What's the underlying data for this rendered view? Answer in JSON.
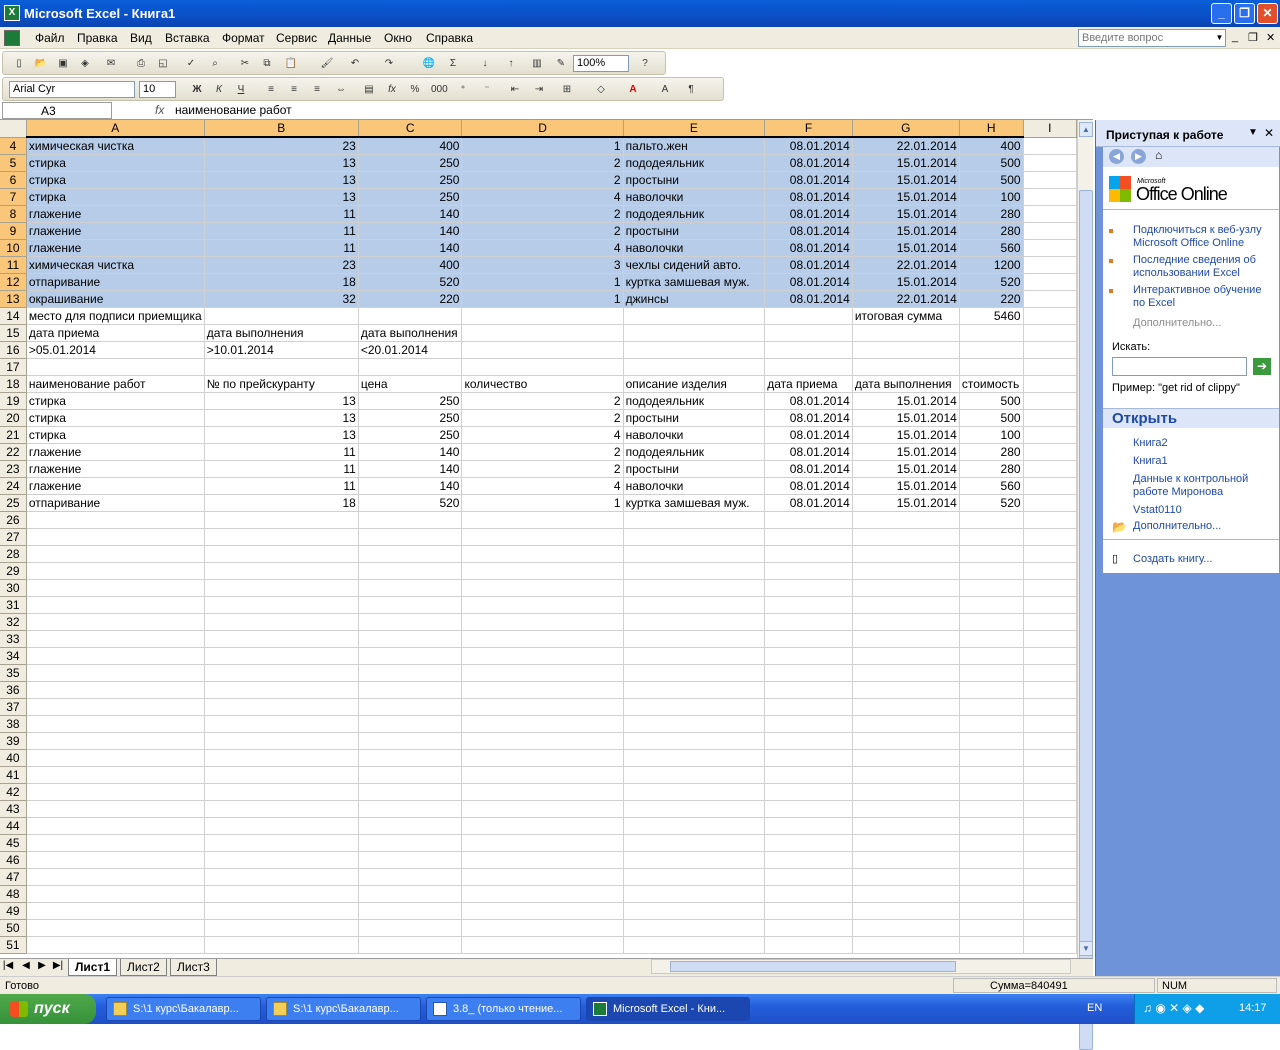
{
  "window": {
    "title": "Microsoft Excel - Книга1"
  },
  "menu": [
    "Файл",
    "Правка",
    "Вид",
    "Вставка",
    "Формат",
    "Сервис",
    "Данные",
    "Окно",
    "Справка"
  ],
  "ask_placeholder": "Введите вопрос",
  "toolbar": {
    "zoom": "100%",
    "font": "Arial Cyr",
    "size": "10"
  },
  "formula_bar": {
    "cell_ref": "A3",
    "fx": "fx",
    "value": "наименование работ"
  },
  "columns": [
    "A",
    "B",
    "C",
    "D",
    "E",
    "F",
    "G",
    "H",
    "I"
  ],
  "rows": [
    {
      "n": "4",
      "c": [
        "химическая чистка",
        "23",
        "400",
        "1",
        "пальто.жен",
        "08.01.2014",
        "22.01.2014",
        "400"
      ],
      "hl": true
    },
    {
      "n": "5",
      "c": [
        "стирка",
        "13",
        "250",
        "2",
        "пододеяльник",
        "08.01.2014",
        "15.01.2014",
        "500"
      ],
      "hl": true
    },
    {
      "n": "6",
      "c": [
        "стирка",
        "13",
        "250",
        "2",
        "простыни",
        "08.01.2014",
        "15.01.2014",
        "500"
      ],
      "hl": true
    },
    {
      "n": "7",
      "c": [
        "стирка",
        "13",
        "250",
        "4",
        "наволочки",
        "08.01.2014",
        "15.01.2014",
        "100"
      ],
      "hl": true
    },
    {
      "n": "8",
      "c": [
        "глажение",
        "11",
        "140",
        "2",
        "пододеяльник",
        "08.01.2014",
        "15.01.2014",
        "280"
      ],
      "hl": true
    },
    {
      "n": "9",
      "c": [
        "глажение",
        "11",
        "140",
        "2",
        "простыни",
        "08.01.2014",
        "15.01.2014",
        "280"
      ],
      "hl": true
    },
    {
      "n": "10",
      "c": [
        "глажение",
        "11",
        "140",
        "4",
        "наволочки",
        "08.01.2014",
        "15.01.2014",
        "560"
      ],
      "hl": true
    },
    {
      "n": "11",
      "c": [
        "химическая чистка",
        "23",
        "400",
        "3",
        "чехлы сидений авто.",
        "08.01.2014",
        "22.01.2014",
        "1200"
      ],
      "hl": true
    },
    {
      "n": "12",
      "c": [
        "отпаривание",
        "18",
        "520",
        "1",
        "куртка замшевая муж.",
        "08.01.2014",
        "15.01.2014",
        "520"
      ],
      "hl": true
    },
    {
      "n": "13",
      "c": [
        "окрашивание",
        "32",
        "220",
        "1",
        "джинсы",
        "08.01.2014",
        "22.01.2014",
        "220"
      ],
      "hl": true
    },
    {
      "n": "14",
      "c": [
        "место для подписи приемщика",
        "",
        "",
        "",
        "",
        "",
        "итоговая сумма",
        "5460"
      ]
    },
    {
      "n": "15",
      "c": [
        "дата приема",
        "дата выполнения",
        "дата выполнения",
        "",
        "",
        "",
        "",
        ""
      ]
    },
    {
      "n": "16",
      "c": [
        ">05.01.2014",
        ">10.01.2014",
        "<20.01.2014",
        "",
        "",
        "",
        "",
        ""
      ]
    },
    {
      "n": "17",
      "c": [
        "",
        "",
        "",
        "",
        "",
        "",
        "",
        ""
      ]
    },
    {
      "n": "18",
      "c": [
        "наименование работ",
        "№ по прейскуранту",
        "цена",
        "количество",
        "описание изделия",
        "дата приема",
        "дата выполнения",
        "стоимость"
      ]
    },
    {
      "n": "19",
      "c": [
        "стирка",
        "13",
        "250",
        "2",
        "пододеяльник",
        "08.01.2014",
        "15.01.2014",
        "500"
      ]
    },
    {
      "n": "20",
      "c": [
        "стирка",
        "13",
        "250",
        "2",
        "простыни",
        "08.01.2014",
        "15.01.2014",
        "500"
      ]
    },
    {
      "n": "21",
      "c": [
        "стирка",
        "13",
        "250",
        "4",
        "наволочки",
        "08.01.2014",
        "15.01.2014",
        "100"
      ]
    },
    {
      "n": "22",
      "c": [
        "глажение",
        "11",
        "140",
        "2",
        "пододеяльник",
        "08.01.2014",
        "15.01.2014",
        "280"
      ]
    },
    {
      "n": "23",
      "c": [
        "глажение",
        "11",
        "140",
        "2",
        "простыни",
        "08.01.2014",
        "15.01.2014",
        "280"
      ]
    },
    {
      "n": "24",
      "c": [
        "глажение",
        "11",
        "140",
        "4",
        "наволочки",
        "08.01.2014",
        "15.01.2014",
        "560"
      ]
    },
    {
      "n": "25",
      "c": [
        "отпаривание",
        "18",
        "520",
        "1",
        "куртка замшевая муж.",
        "08.01.2014",
        "15.01.2014",
        "520"
      ]
    }
  ],
  "empty_rows": [
    "26",
    "27",
    "28",
    "29",
    "30",
    "31",
    "32",
    "33",
    "34",
    "35",
    "36",
    "37",
    "38",
    "39",
    "40",
    "41",
    "42",
    "43",
    "44",
    "45",
    "46",
    "47",
    "48",
    "49",
    "50",
    "51"
  ],
  "sheets": [
    "Лист1",
    "Лист2",
    "Лист3"
  ],
  "taskpane": {
    "title": "Приступая к работе",
    "brand_small": "Microsoft",
    "brand": "Office Online",
    "links": [
      "Подключиться к веб-узлу Microsoft Office Online",
      "Последние сведения об использовании Excel",
      "Интерактивное обучение по Excel"
    ],
    "more1": "Дополнительно...",
    "search_label": "Искать:",
    "example": "Пример:  \"get rid of clippy\"",
    "open_title": "Открыть",
    "files": [
      "Книга2",
      "Книга1",
      "Данные к контрольной работе Миронова",
      "Vstat0110"
    ],
    "more2": "Дополнительно...",
    "create": "Создать книгу..."
  },
  "status": {
    "ready": "Готово",
    "sum": "Сумма=840491",
    "num": "NUM"
  },
  "taskbar": {
    "start": "пуск",
    "tasks": [
      "S:\\1 курс\\Бакалавр...",
      "S:\\1 курс\\Бакалавр...",
      "3.8_ (только чтение...",
      "Microsoft Excel - Кни..."
    ],
    "lang": "EN",
    "clock": "14:17"
  }
}
